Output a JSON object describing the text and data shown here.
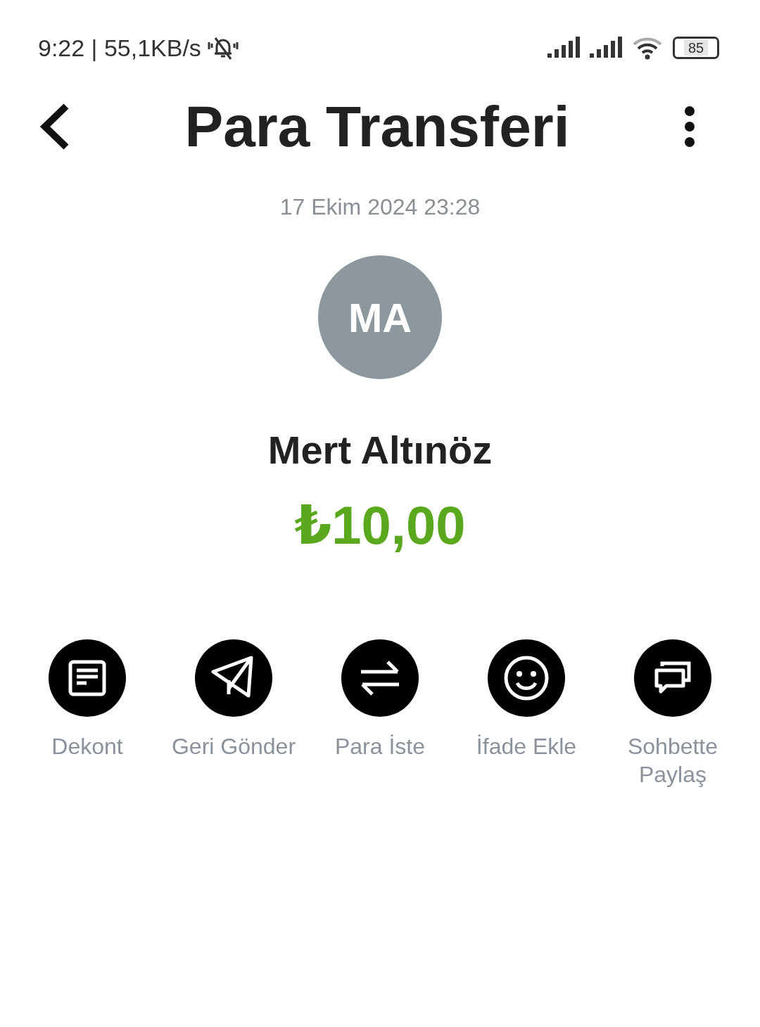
{
  "status_bar": {
    "time": "9:22 | 55,1KB/s",
    "battery": "85"
  },
  "header": {
    "title": "Para Transferi"
  },
  "transfer": {
    "date": "17 Ekim 2024 23:28",
    "initials": "MA",
    "name": "Mert Altınöz",
    "amount": "₺10,00"
  },
  "actions": [
    {
      "kind": "receipt",
      "label": "Dekont"
    },
    {
      "kind": "send",
      "label": "Geri Gönder"
    },
    {
      "kind": "swap",
      "label": "Para İste"
    },
    {
      "kind": "smile",
      "label": "İfade Ekle"
    },
    {
      "kind": "chat",
      "label": "Sohbette Paylaş"
    }
  ]
}
